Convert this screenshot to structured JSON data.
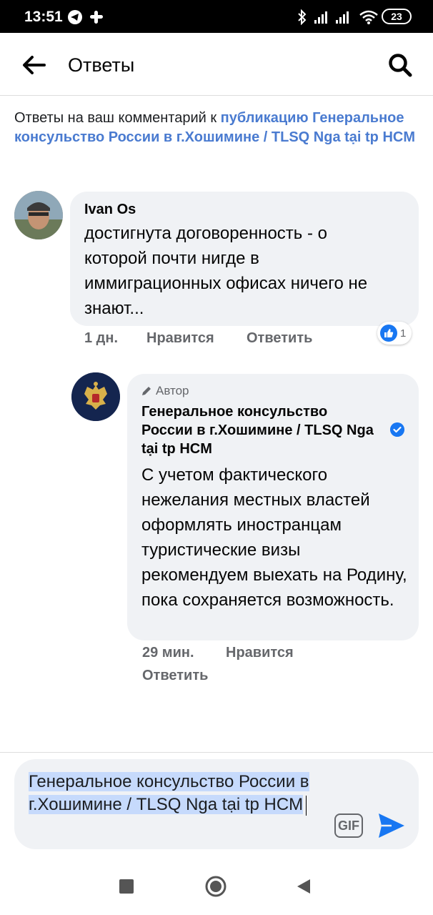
{
  "status_bar": {
    "time": "13:51",
    "battery": "23",
    "icons": [
      "telegram-icon",
      "slack-icon",
      "bluetooth-icon",
      "signal-icon",
      "signal-icon",
      "wifi-icon",
      "battery-icon"
    ]
  },
  "header": {
    "title": "Ответы",
    "back_icon": "arrow-left-icon",
    "search_icon": "search-icon"
  },
  "intro": {
    "prefix": "Ответы на ваш комментарий к ",
    "link": "публикацию Генеральное консульство России в г.Хошимине / TLSQ Nga tại tp HCM"
  },
  "comments": [
    {
      "author": "Ivan Os",
      "text": "достигнута договоренность - о которой почти нигде в иммиграционных офисах ничего не знают...",
      "time": "1 дн.",
      "like_label": "Нравится",
      "reply_label": "Ответить",
      "reaction_count": "1"
    },
    {
      "badge": "Автор",
      "author": "Генеральное консульство России в г.Хошимине / TLSQ Nga tại tp HCM",
      "text": "С учетом фактического нежелания местных властей оформлять иностранцам туристические визы рекомендуем выехать на Родину, пока сохраняется возможность.",
      "time": "29 мин.",
      "like_label": "Нравится",
      "reply_label": "Ответить"
    }
  ],
  "composer": {
    "text": "Генеральное консульство России в г.Хошимине / TLSQ Nga tại tp HCM",
    "gif_label": "GIF"
  },
  "colors": {
    "link": "#4a7bd0",
    "like_blue": "#1877f2",
    "bubble": "#f0f2f5",
    "meta": "#65676b"
  }
}
